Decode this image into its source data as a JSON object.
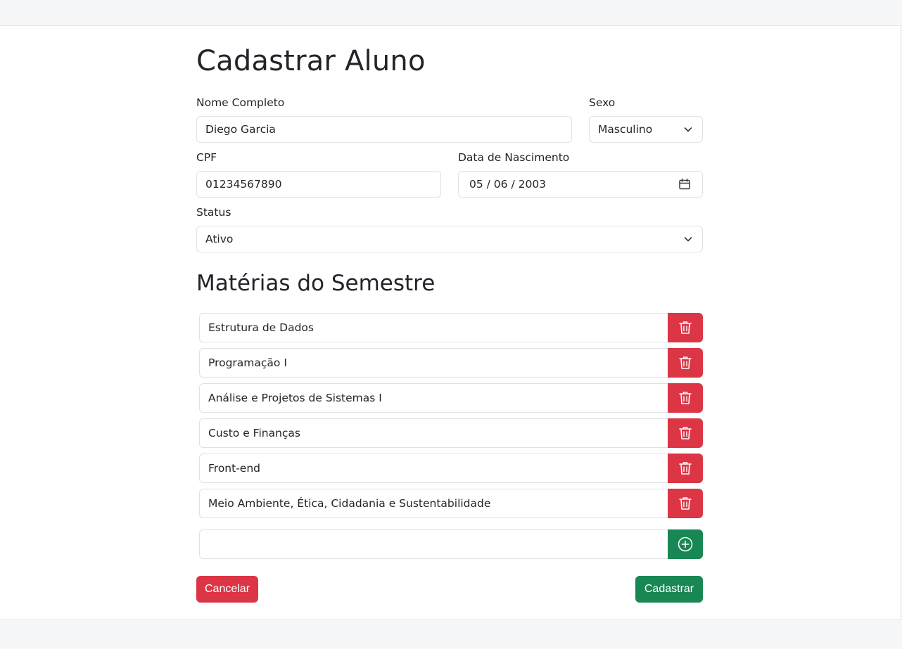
{
  "page": {
    "title": "Cadastrar Aluno",
    "section_title": "Matérias do Semestre"
  },
  "form": {
    "nome": {
      "label": "Nome Completo",
      "value": "Diego Garcia"
    },
    "sexo": {
      "label": "Sexo",
      "value": "Masculino",
      "icon": "chevron-down-icon"
    },
    "cpf": {
      "label": "CPF",
      "value": "01234567890"
    },
    "nascimento": {
      "label": "Data de Nascimento",
      "value": "05 / 06 / 2003",
      "icon": "calendar-icon"
    },
    "status": {
      "label": "Status",
      "value": "Ativo",
      "icon": "chevron-down-icon"
    }
  },
  "subjects": [
    "Estrutura de Dados",
    "Programação I",
    "Análise e Projetos de Sistemas I",
    "Custo e Finanças",
    "Front-end",
    "Meio Ambiente, Ética, Cidadania e Sustentabilidade"
  ],
  "new_subject": {
    "value": "",
    "icon": "plus-circle-icon"
  },
  "delete_icon": "trash-icon",
  "buttons": {
    "cancel": "Cancelar",
    "submit": "Cadastrar"
  },
  "colors": {
    "danger": "#dc3545",
    "success": "#198754",
    "border": "#dee2e6",
    "background": "#f6f7f9"
  }
}
